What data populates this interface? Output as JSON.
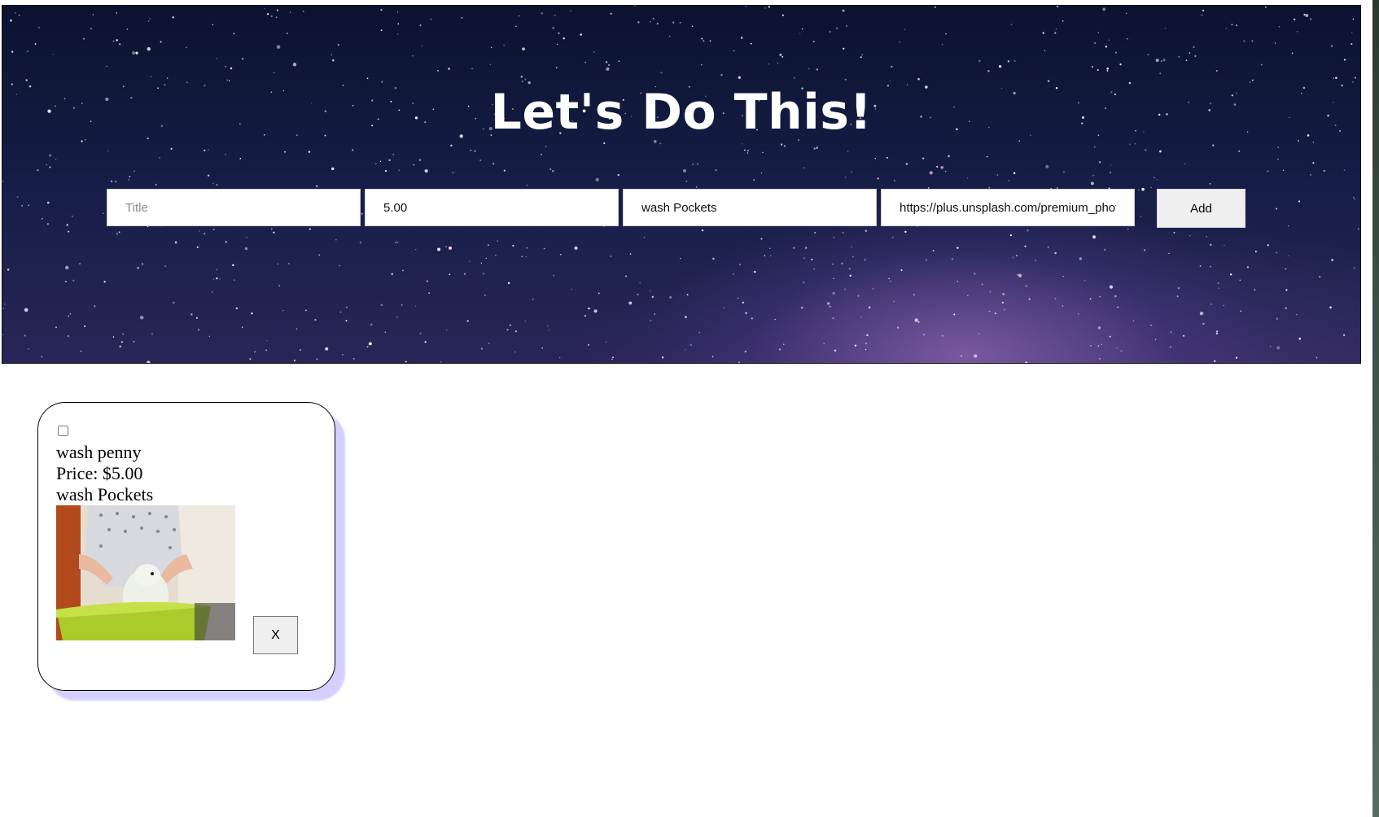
{
  "header": {
    "title": "Let's Do This!"
  },
  "form": {
    "title_placeholder": "Title",
    "title_value": "",
    "price_value": "5.00",
    "description_value": "wash Pockets",
    "image_url_value": "https://plus.unsplash.com/premium_photo",
    "add_label": "Add"
  },
  "card": {
    "checked": false,
    "title": "wash penny",
    "price_text": "Price: $5.00",
    "description": "wash Pockets",
    "image_subject": "dog-bath-photo",
    "remove_label": "X"
  },
  "colors": {
    "card_shadow": "#d4d0fb",
    "hero_base": "#141c44",
    "button_bg": "#efefef"
  }
}
